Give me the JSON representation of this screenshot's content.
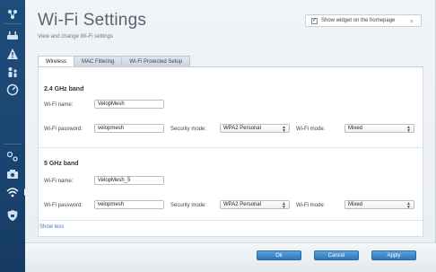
{
  "page": {
    "title": "Wi-Fi Settings",
    "subtitle": "View and change Wi-Fi settings"
  },
  "widget": {
    "label": "Show widget on the homepage",
    "checked": true,
    "check_mark": "✓",
    "close": "×"
  },
  "tabs": [
    {
      "label": "Wireless",
      "active": true
    },
    {
      "label": "MAC Filtering",
      "active": false
    },
    {
      "label": "Wi-Fi Protected Setup",
      "active": false
    }
  ],
  "band_24": {
    "title": "2.4 GHz band",
    "name_label": "Wi-Fi name:",
    "name_value": "VelopMesh",
    "password_label": "Wi-Fi password:",
    "password_value": "velopmesh",
    "security_label": "Security mode:",
    "security_value": "WPA2 Personal",
    "mode_label": "Wi-Fi mode:",
    "mode_value": "Mixed"
  },
  "band_5": {
    "title": "5 GHz band",
    "name_label": "Wi-Fi name:",
    "name_value": "VelopMesh_5",
    "password_label": "Wi-Fi password:",
    "password_value": "velopmesh",
    "security_label": "Security mode:",
    "security_value": "WPA2 Personal",
    "mode_label": "Wi-Fi mode:",
    "mode_value": "Mixed"
  },
  "links": {
    "show_less": "Show less"
  },
  "footer": {
    "ok": "Ok",
    "cancel": "Cancel",
    "apply": "Apply"
  },
  "sidebar_icons": [
    "network-map-icon",
    "router-icon",
    "warning-icon",
    "parental-controls-icon",
    "speed-icon",
    "connectivity-icon",
    "camera-icon",
    "wifi-icon",
    "security-shield-icon"
  ],
  "colors": {
    "sidebar": "#1e4d7a",
    "accent_button": "#2e78be",
    "link": "#3a7bc0"
  }
}
